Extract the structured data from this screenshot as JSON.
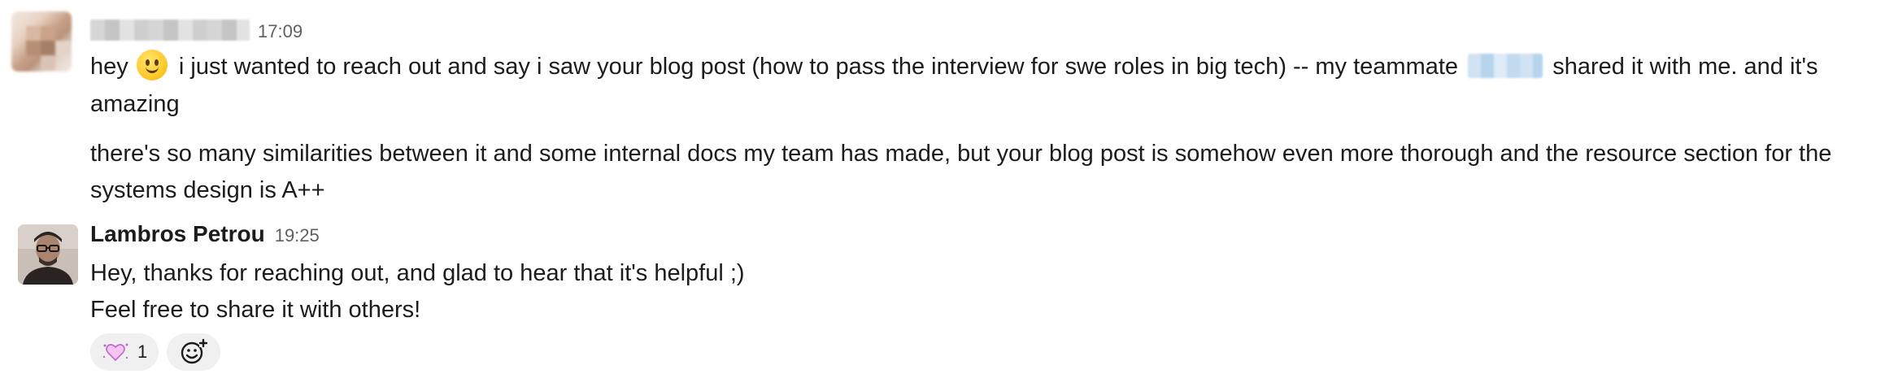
{
  "messages": [
    {
      "sender": "",
      "time": "17:09",
      "paragraphs": {
        "p1_before_emoji": "hey",
        "p1_emoji": "slightly-smiling-face-emoji",
        "p1_after_emoji": "i just wanted to reach out and say i saw your blog post (how to pass the interview for swe roles in big tech) -- my teammate",
        "p1_after_mention": "shared it with me. and it's",
        "p1_line2": "amazing",
        "p2_line1": "there's so many similarities between it and some internal docs my team has made, but your blog post is somehow even more thorough and the resource section for the",
        "p2_line2": "systems design is A++"
      }
    },
    {
      "sender": "Lambros Petrou",
      "time": "19:25",
      "lines": [
        "Hey, thanks for reaching out, and glad to hear that it's helpful ;)",
        "Feel free to share it with others!"
      ],
      "reactions": [
        {
          "icon": "sparkling-heart-icon",
          "count": "1"
        }
      ],
      "add_reaction_icon": "add-reaction-icon"
    }
  ]
}
